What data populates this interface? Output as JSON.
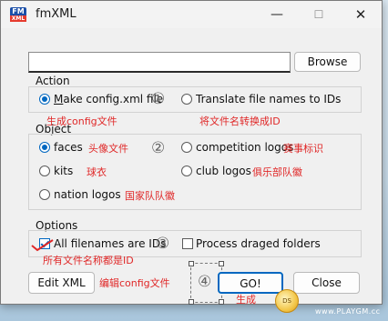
{
  "window": {
    "title": "fmXML",
    "icon_line1": "FM",
    "icon_line2": "XML",
    "minimize": "—",
    "maximize": "☐",
    "close": "✕"
  },
  "path": {
    "value": ""
  },
  "buttons": {
    "browse": "Browse",
    "edit_xml": "Edit XML",
    "go": "GO!",
    "close": "Close"
  },
  "action": {
    "label": "Action",
    "options": [
      {
        "label": "Make config.xml file",
        "selected": true
      },
      {
        "label": "Translate file names to IDs",
        "selected": false
      }
    ]
  },
  "object": {
    "label": "Object",
    "options": [
      {
        "label": "faces",
        "selected": true
      },
      {
        "label": "competition logos",
        "selected": false
      },
      {
        "label": "kits",
        "selected": false
      },
      {
        "label": "club logos",
        "selected": false
      },
      {
        "label": "nation logos",
        "selected": false
      }
    ]
  },
  "options": {
    "label": "Options",
    "items": [
      {
        "label": "All filenames are IDs",
        "checked": true
      },
      {
        "label": "Process draged folders",
        "checked": false
      }
    ]
  },
  "annotations": {
    "n1": "①",
    "n2": "②",
    "n3": "③",
    "n4": "④",
    "make_config": "生成config文件",
    "translate": "将文件名转换成ID",
    "faces": "头像文件",
    "competition": "赛事标识",
    "kits": "球衣",
    "club": "俱乐部队徽",
    "nation": "国家队队徽",
    "all_ids": "所有文件名称都是ID",
    "edit_config": "编辑config文件",
    "generate": "生成"
  },
  "watermark": "www.PLAYGM.cc",
  "badge_text": "DS",
  "colors": {
    "accent": "#0067c0",
    "annotation": "#e02828"
  }
}
